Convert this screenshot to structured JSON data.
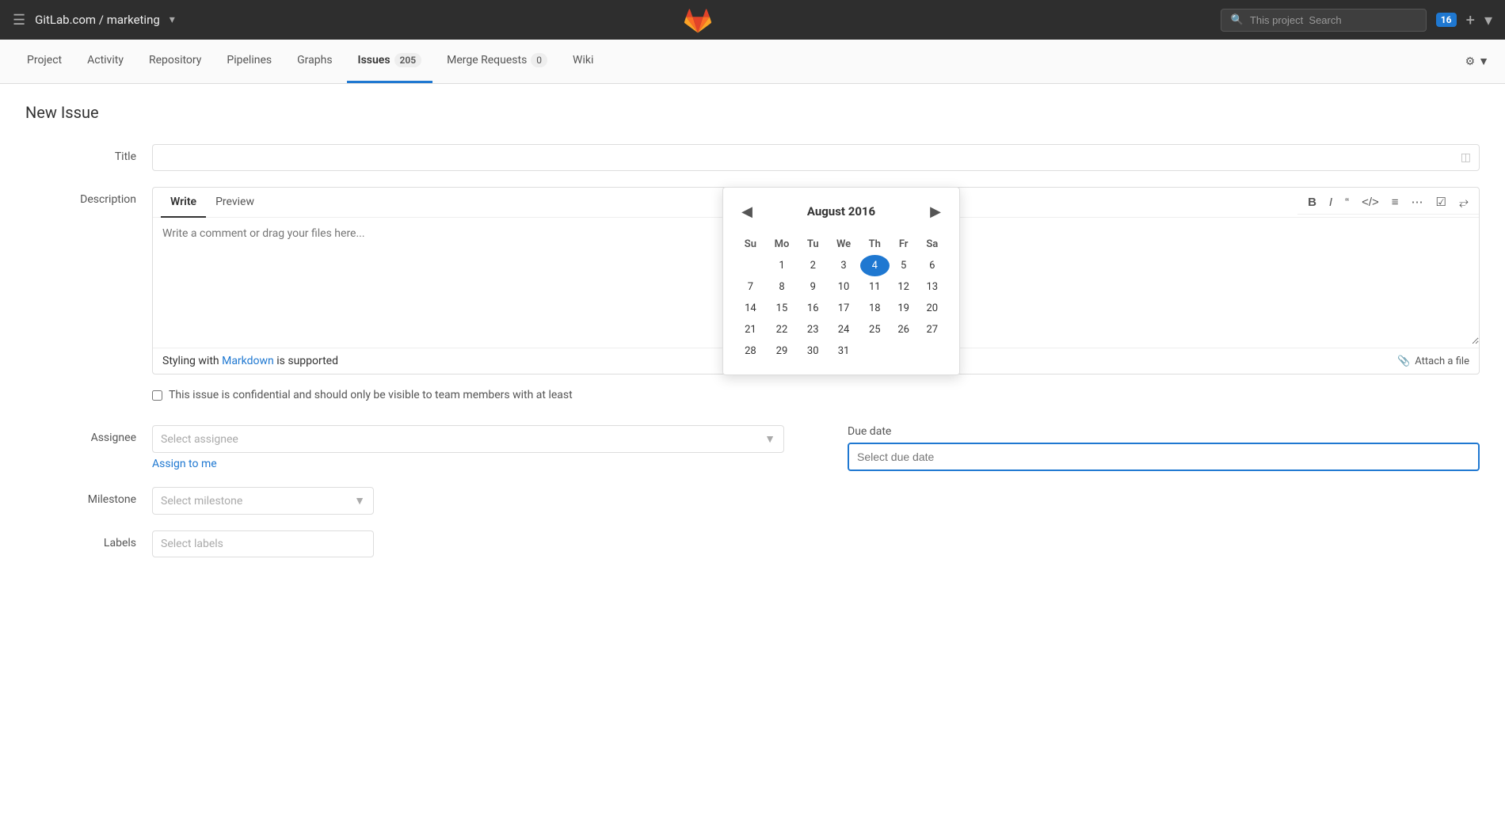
{
  "topbar": {
    "hamburger": "≡",
    "title": "GitLab.com / marketing",
    "title_arrow": "▾",
    "search_placeholder": "This project  Search",
    "notification_count": "16",
    "plus_icon": "+",
    "arrow_icon": "▾"
  },
  "nav": {
    "items": [
      {
        "id": "project",
        "label": "Project",
        "active": false,
        "badge": null
      },
      {
        "id": "activity",
        "label": "Activity",
        "active": false,
        "badge": null
      },
      {
        "id": "repository",
        "label": "Repository",
        "active": false,
        "badge": null
      },
      {
        "id": "pipelines",
        "label": "Pipelines",
        "active": false,
        "badge": null
      },
      {
        "id": "graphs",
        "label": "Graphs",
        "active": false,
        "badge": null
      },
      {
        "id": "issues",
        "label": "Issues",
        "active": true,
        "badge": "205"
      },
      {
        "id": "merge-requests",
        "label": "Merge Requests",
        "active": false,
        "badge": "0"
      },
      {
        "id": "wiki",
        "label": "Wiki",
        "active": false,
        "badge": null
      }
    ],
    "settings_icon": "⚙"
  },
  "page": {
    "title": "New Issue",
    "form": {
      "title_label": "Title",
      "title_placeholder": "",
      "description_label": "Description",
      "description_tab_write": "Write",
      "description_tab_preview": "Preview",
      "description_placeholder": "Write a comment or drag your files here...",
      "markdown_note": "Styling with ",
      "markdown_link_text": "Markdown",
      "markdown_note2": " is supported",
      "confidential_text": "This issue is confidential and should only be visible to team members with at least",
      "assignee_label": "Assignee",
      "assignee_placeholder": "Select assignee",
      "assign_me": "Assign to me",
      "due_date_label": "Due date",
      "due_date_placeholder": "Select due date",
      "milestone_label": "Milestone",
      "milestone_placeholder": "Select milestone",
      "labels_label": "Labels",
      "labels_placeholder": "Select labels",
      "attach_file": "Attach a file"
    }
  },
  "calendar": {
    "month": "August 2016",
    "days_header": [
      "Su",
      "Mo",
      "Tu",
      "We",
      "Th",
      "Fr",
      "Sa"
    ],
    "weeks": [
      [
        null,
        1,
        2,
        3,
        4,
        5,
        6
      ],
      [
        7,
        8,
        9,
        10,
        11,
        12,
        13
      ],
      [
        14,
        15,
        16,
        17,
        18,
        19,
        20
      ],
      [
        21,
        22,
        23,
        24,
        25,
        26,
        27
      ],
      [
        28,
        29,
        30,
        31,
        null,
        null,
        null
      ]
    ],
    "selected_day": 4
  },
  "toolbar_buttons": [
    "B",
    "I",
    "❝",
    "</>",
    "≡",
    "⊟",
    "☑",
    "⤢"
  ]
}
